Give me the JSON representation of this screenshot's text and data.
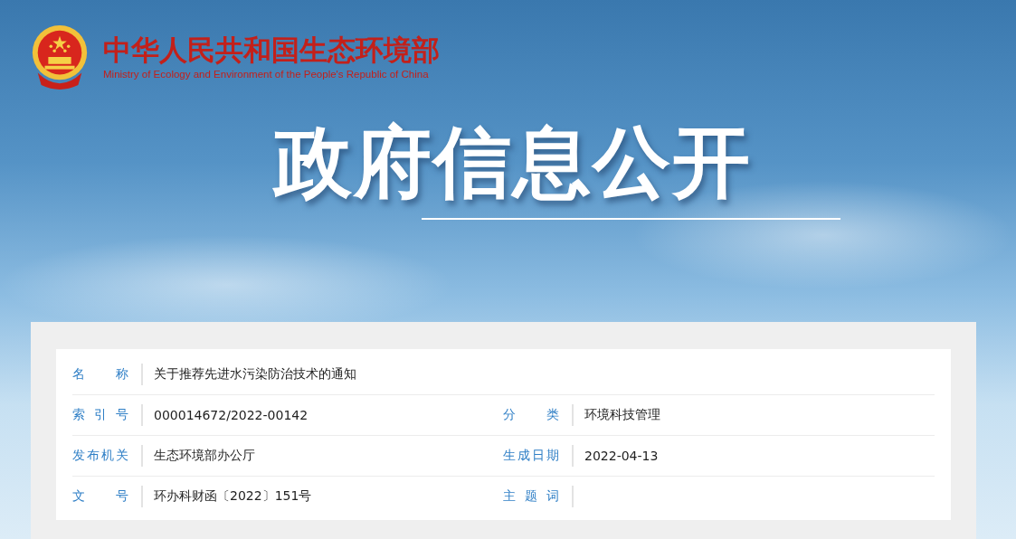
{
  "header": {
    "title": "中华人民共和国生态环境部",
    "subtitle": "Ministry of Ecology and Environment of the People's Republic of China"
  },
  "banner": {
    "title": "政府信息公开"
  },
  "info_rows": [
    [
      {
        "label": "名称",
        "value": "关于推荐先进水污染防治技术的通知"
      }
    ],
    [
      {
        "label": "索引号",
        "value": "000014672/2022-00142"
      },
      {
        "label": "分类",
        "value": "环境科技管理"
      }
    ],
    [
      {
        "label": "发布机关",
        "value": "生态环境部办公厅"
      },
      {
        "label": "生成日期",
        "value": "2022-04-13"
      }
    ],
    [
      {
        "label": "文号",
        "value": "环办科财函〔2022〕151号"
      },
      {
        "label": "主题词"
      }
    ]
  ]
}
